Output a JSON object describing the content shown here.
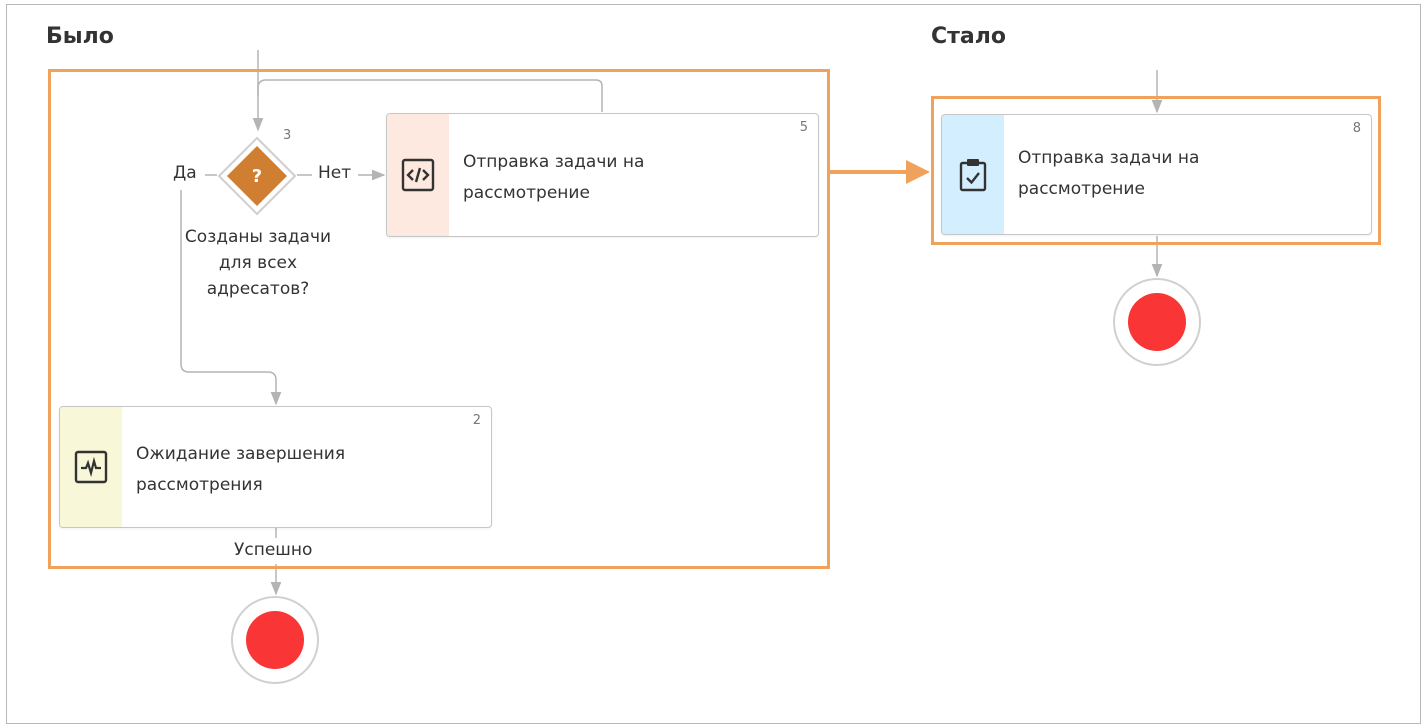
{
  "before": {
    "title": "Было",
    "gateway": {
      "number": "3",
      "symbol": "?",
      "question": "Созданы задачи\nдля всех\nадресатов?",
      "yes_label": "Да",
      "no_label": "Нет"
    },
    "task_send": {
      "number": "5",
      "label": "Отправка задачи на\nрассмотрение",
      "icon": "code-icon"
    },
    "task_wait": {
      "number": "2",
      "label": "Ожидание завершения\nрассмотрения",
      "icon": "monitor-pulse-icon"
    },
    "success_label": "Успешно"
  },
  "after": {
    "title": "Стало",
    "task_send": {
      "number": "8",
      "label": "Отправка задачи на\nрассмотрение",
      "icon": "clipboard-check-icon"
    }
  },
  "colors": {
    "highlight": "#f0a25c",
    "gateway": "#d07f32",
    "end_event": "#f93535",
    "strip_send_before": "#fde9df",
    "strip_wait": "#f8f8d9",
    "strip_send_after": "#d3efff"
  }
}
